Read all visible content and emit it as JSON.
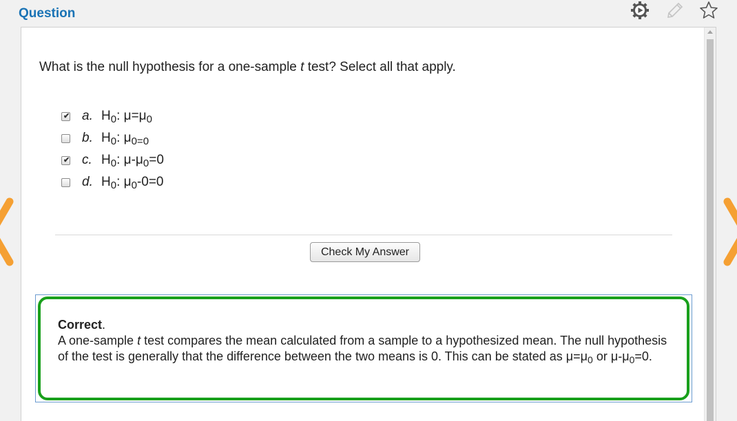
{
  "header": {
    "title": "Question"
  },
  "toolbar": {
    "icons": [
      "play-settings-icon",
      "pencil-icon",
      "star-icon"
    ]
  },
  "question": {
    "prefix": "What is the null hypothesis for a one-sample ",
    "italic": "t",
    "suffix": " test? Select all that apply."
  },
  "options": [
    {
      "letter": "a.",
      "checked": true,
      "h": "H",
      "hsub": "0",
      "colon": ": ",
      "parts": [
        "μ=μ",
        "0",
        ""
      ]
    },
    {
      "letter": "b.",
      "checked": false,
      "h": "H",
      "hsub": "0",
      "colon": ": ",
      "parts": [
        "μ",
        "0=0",
        ""
      ]
    },
    {
      "letter": "c.",
      "checked": true,
      "h": "H",
      "hsub": "0",
      "colon": ": ",
      "parts": [
        "μ-μ",
        "0",
        "=0"
      ]
    },
    {
      "letter": "d.",
      "checked": false,
      "h": "H",
      "hsub": "0",
      "colon": ": ",
      "parts": [
        "μ",
        "0",
        "-0=0"
      ]
    }
  ],
  "check_button": {
    "label": "Check My Answer"
  },
  "feedback": {
    "status": "Correct",
    "status_punct": ".",
    "line1_prefix": "A one-sample ",
    "line1_italic": "t",
    "line1_suffix": " test compares the mean calculated from a sample to a hypothesized mean. The null hypothesis of the test is generally that the difference between the two means is 0. This can be stated as ",
    "eq1_main": "μ=μ",
    "eq1_sub": "0",
    "or_text": " or ",
    "eq2_main": "μ-μ",
    "eq2_sub": "0",
    "eq2_tail": "=0."
  },
  "colors": {
    "title": "#1a73b5",
    "correct_border": "#19a01c",
    "nav_arrow": "#f5a033"
  }
}
